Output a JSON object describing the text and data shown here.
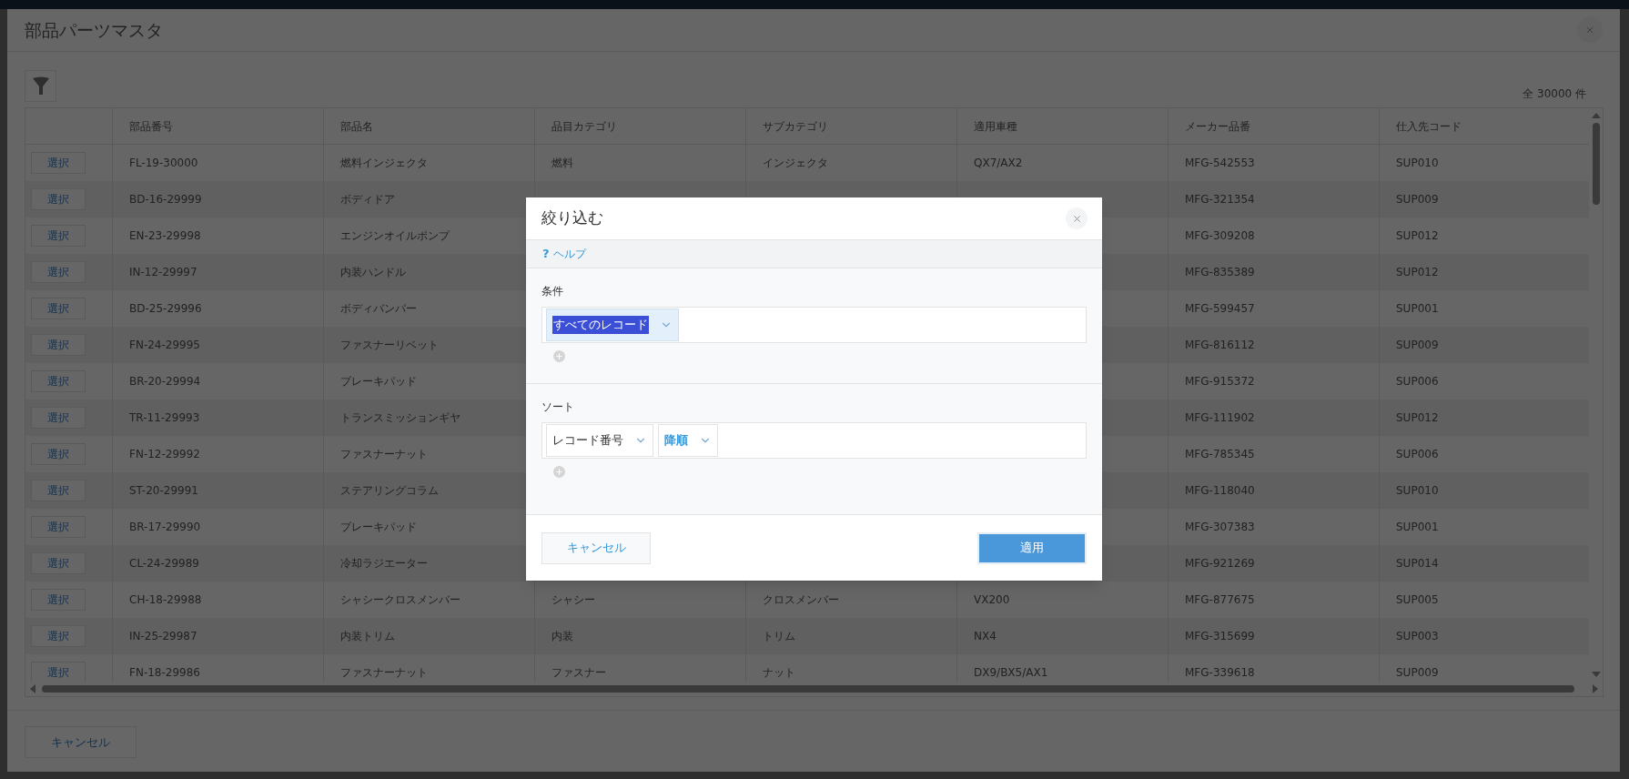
{
  "window": {
    "title": "部品パーツマスタ"
  },
  "toolbar": {
    "record_count": "全 30000 件"
  },
  "table": {
    "columns": [
      "部品番号",
      "部品名",
      "品目カテゴリ",
      "サブカテゴリ",
      "適用車種",
      "メーカー品番",
      "仕入先コード"
    ],
    "rows": [
      {
        "action": "選択",
        "cells": [
          "FL-19-30000",
          "燃料インジェクタ",
          "燃料",
          "インジェクタ",
          "QX7/AX2",
          "MFG-542553",
          "SUP010"
        ]
      },
      {
        "action": "選択",
        "cells": [
          "BD-16-29999",
          "ボディドア",
          null,
          null,
          null,
          "MFG-321354",
          "SUP009"
        ]
      },
      {
        "action": "選択",
        "cells": [
          "EN-23-29998",
          "エンジンオイルポンプ",
          null,
          null,
          null,
          "MFG-309208",
          "SUP012"
        ]
      },
      {
        "action": "選択",
        "cells": [
          "IN-12-29997",
          "内装ハンドル",
          null,
          null,
          null,
          "MFG-835389",
          "SUP012"
        ]
      },
      {
        "action": "選択",
        "cells": [
          "BD-25-29996",
          "ボディバンパー",
          null,
          null,
          null,
          "MFG-599457",
          "SUP001"
        ]
      },
      {
        "action": "選択",
        "cells": [
          "FN-24-29995",
          "ファスナーリベット",
          null,
          null,
          null,
          "MFG-816112",
          "SUP009"
        ]
      },
      {
        "action": "選択",
        "cells": [
          "BR-20-29994",
          "ブレーキパッド",
          null,
          null,
          null,
          "MFG-915372",
          "SUP006"
        ]
      },
      {
        "action": "選択",
        "cells": [
          "TR-11-29993",
          "トランスミッションギヤ",
          null,
          null,
          null,
          "MFG-111902",
          "SUP012"
        ]
      },
      {
        "action": "選択",
        "cells": [
          "FN-12-29992",
          "ファスナーナット",
          null,
          null,
          null,
          "MFG-785345",
          "SUP006"
        ]
      },
      {
        "action": "選択",
        "cells": [
          "ST-20-29991",
          "ステアリングコラム",
          null,
          null,
          null,
          "MFG-118040",
          "SUP010"
        ]
      },
      {
        "action": "選択",
        "cells": [
          "BR-17-29990",
          "ブレーキパッド",
          null,
          null,
          null,
          "MFG-307383",
          "SUP001"
        ]
      },
      {
        "action": "選択",
        "cells": [
          "CL-24-29989",
          "冷却ラジエーター",
          null,
          null,
          null,
          "MFG-921269",
          "SUP014"
        ]
      },
      {
        "action": "選択",
        "cells": [
          "CH-18-29988",
          "シャシークロスメンバー",
          "シャシー",
          "クロスメンバー",
          "VX200",
          "MFG-877675",
          "SUP005"
        ]
      },
      {
        "action": "選択",
        "cells": [
          "IN-25-29987",
          "内装トリム",
          "内装",
          "トリム",
          "NX4",
          "MFG-315699",
          "SUP003"
        ]
      },
      {
        "action": "選択",
        "cells": [
          "FN-18-29986",
          "ファスナーナット",
          "ファスナー",
          "ナット",
          "DX9/BX5/AX1",
          "MFG-339618",
          "SUP009"
        ]
      }
    ]
  },
  "footer": {
    "cancel": "キャンセル"
  },
  "dialog": {
    "title": "絞り込む",
    "help_mark": "?",
    "help": "ヘルプ",
    "sections": [
      {
        "label": "条件",
        "selects": [
          {
            "value": "すべてのレコード",
            "kind": "highlighted"
          }
        ]
      },
      {
        "label": "ソート",
        "selects": [
          {
            "value": "レコード番号",
            "kind": "plain"
          },
          {
            "value": "降順",
            "kind": "accent"
          }
        ]
      }
    ],
    "buttons": [
      {
        "label": "キャンセル",
        "kind": "secondary"
      },
      {
        "label": "適用",
        "kind": "primary"
      }
    ]
  }
}
